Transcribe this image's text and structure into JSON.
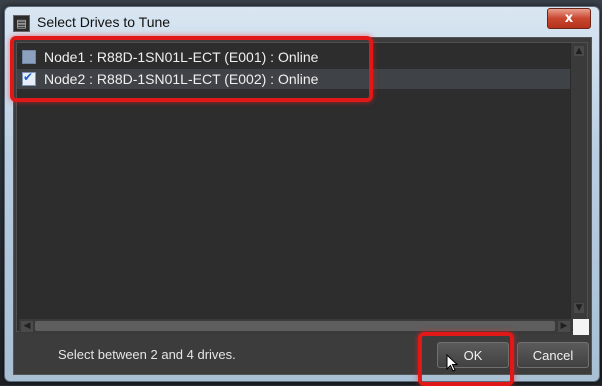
{
  "window": {
    "title": "Select Drives to Tune",
    "close_glyph": "x"
  },
  "drives": {
    "items": [
      {
        "label": "Node1 : R88D-1SN01L-ECT (E001) : Online",
        "checked": true,
        "enabled": false
      },
      {
        "label": "Node2 : R88D-1SN01L-ECT (E002) : Online",
        "checked": true,
        "enabled": true
      }
    ]
  },
  "footer": {
    "hint": "Select between 2 and 4 drives.",
    "ok_label": "OK",
    "cancel_label": "Cancel"
  },
  "colors": {
    "highlight": "#e11818",
    "dialog_bg": "#3c3c3c"
  }
}
